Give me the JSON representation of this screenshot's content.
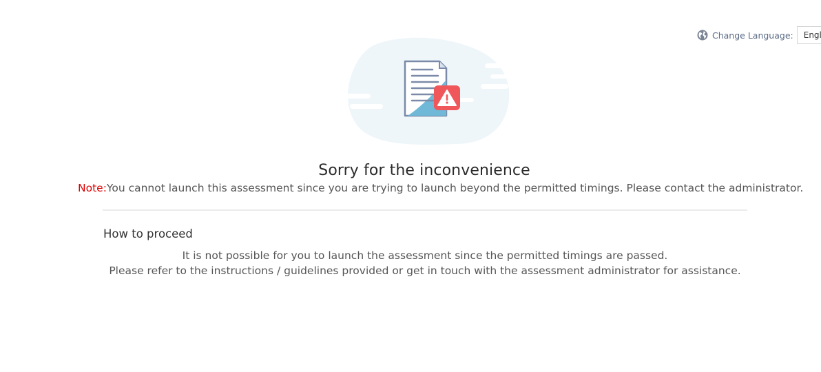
{
  "language": {
    "label": "Change Language:",
    "selected": "English"
  },
  "message": {
    "title": "Sorry for the inconvenience",
    "note_label": "Note:",
    "note_text": "You cannot launch this assessment since you are trying to launch beyond the permitted timings. Please contact the administrator."
  },
  "proceed": {
    "heading": "How to proceed",
    "line1": "It is not possible for you to launch the assessment since the permitted timings are passed.",
    "line2": "Please refer to the instructions / guidelines provided or get in touch with the assessment administrator for assistance."
  },
  "icons": {
    "language": "globe-icon",
    "illustration": "document-warning-icon"
  },
  "colors": {
    "note_label": "#e00000",
    "warning_badge": "#f0575b",
    "document_accent": "#6fb8d8",
    "blob_background": "#eef6fa"
  }
}
